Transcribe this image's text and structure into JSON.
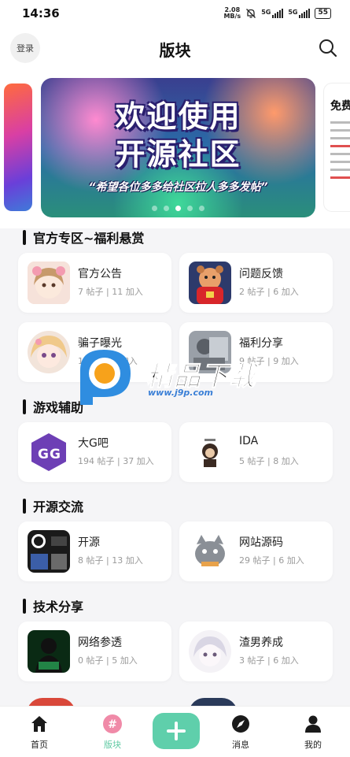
{
  "status_bar": {
    "time": "14:36",
    "speed_value": "2.08",
    "speed_unit": "MB/s",
    "network_1": "5G",
    "network_2": "5G",
    "battery": "55"
  },
  "header": {
    "login_label": "登录",
    "title": "版块",
    "search_icon": "search-icon"
  },
  "banner": {
    "line1": "欢迎使用",
    "line2": "开源社区",
    "subtitle": "“希望各位多多给社区拉人多多发帖”",
    "next_slide_title": "免费"
  },
  "sections": [
    {
      "title": "官方专区~福利悬赏",
      "cards": [
        {
          "name": "官方公告",
          "stats": "7 帖子 | 11 加入"
        },
        {
          "name": "问题反馈",
          "stats": "2 帖子 | 6 加入"
        },
        {
          "name": "骗子曝光",
          "stats": "1 帖子 | 7 加入"
        },
        {
          "name": "福利分享",
          "stats": "9 帖子 | 9 加入"
        }
      ]
    },
    {
      "title": "游戏辅助",
      "cards": [
        {
          "name": "大G吧",
          "stats": "194 帖子 | 37 加入"
        },
        {
          "name": "IDA",
          "stats": "5 帖子 | 8 加入"
        }
      ]
    },
    {
      "title": "开源交流",
      "cards": [
        {
          "name": "开源",
          "stats": "8 帖子 | 13 加入"
        },
        {
          "name": "网站源码",
          "stats": "29 帖子 | 6 加入"
        }
      ]
    },
    {
      "title": "技术分享",
      "cards": [
        {
          "name": "网络参透",
          "stats": "0 帖子 | 5 加入"
        },
        {
          "name": "渣男养成",
          "stats": "3 帖子 | 6 加入"
        }
      ]
    }
  ],
  "watermark": {
    "text": "精品下载",
    "url": "www.j9p.com"
  },
  "tabs": [
    {
      "label": "首页",
      "icon": "home-icon"
    },
    {
      "label": "版块",
      "icon": "hashtag-icon",
      "active": true
    },
    {
      "label": "",
      "icon": "plus-icon"
    },
    {
      "label": "消息",
      "icon": "compass-icon"
    },
    {
      "label": "我的",
      "icon": "person-icon"
    }
  ],
  "colors": {
    "accent": "#5fcfab",
    "active_tab": "#5fc9a3",
    "background": "#f5f5f7"
  }
}
